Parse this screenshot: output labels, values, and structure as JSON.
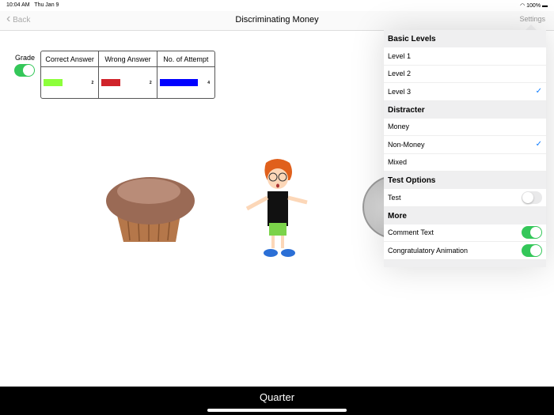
{
  "status": {
    "time": "10:04 AM",
    "date": "Thu Jan 9",
    "battery": "100%"
  },
  "nav": {
    "back": "Back",
    "title": "Discriminating Money",
    "settings": "Settings"
  },
  "grade": {
    "label": "Grade",
    "on": true
  },
  "score": {
    "headers": [
      "Correct Answer",
      "Wrong Answer",
      "No. of Attempt"
    ],
    "values": [
      "2",
      "2",
      "4"
    ],
    "colors": [
      "#8cff3a",
      "#d0232a",
      "#0000ff"
    ]
  },
  "bottom": {
    "label": "Quarter"
  },
  "settings": {
    "basic_levels": {
      "title": "Basic Levels",
      "items": [
        "Level 1",
        "Level 2",
        "Level 3"
      ],
      "selected": "Level 3"
    },
    "distracter": {
      "title": "Distracter",
      "items": [
        "Money",
        "Non-Money",
        "Mixed"
      ],
      "selected": "Non-Money"
    },
    "test_options": {
      "title": "Test Options",
      "test": "Test",
      "test_on": false
    },
    "more": {
      "title": "More",
      "comment": "Comment Text",
      "comment_on": true,
      "congrats": "Congratulatory Animation",
      "congrats_on": true
    }
  },
  "icons": {
    "check": "✓",
    "back": "‹"
  }
}
